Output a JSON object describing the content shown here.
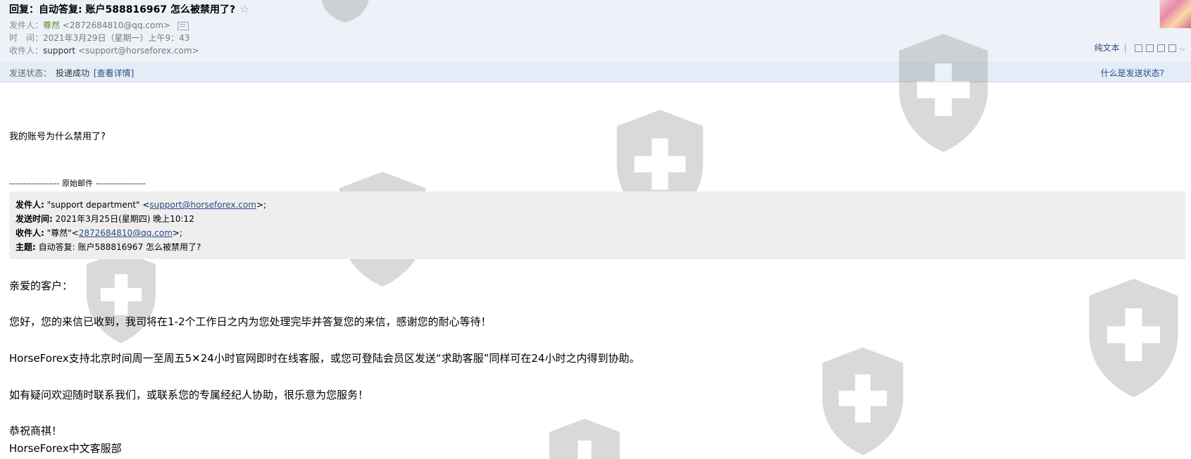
{
  "email": {
    "subject": "回复：自动答复: 账户588816967 怎么被禁用了?",
    "from": {
      "label": "发件人：",
      "name": "尊然",
      "address": "<2872684810@qq.com>"
    },
    "time": {
      "label": "时　间：",
      "value": "2021年3月29日（星期一）上午9：43"
    },
    "to": {
      "label": "收件人：",
      "name": "support",
      "address": "<support@horseforex.com>"
    }
  },
  "toolbar": {
    "plain_text": "纯文本",
    "separator": "|"
  },
  "status_bar": {
    "label": "发送状态：",
    "value": "投递成功",
    "details_link": "[查看详情]",
    "help_link": "什么是发送状态?"
  },
  "body": {
    "question": "我的账号为什么禁用了?",
    "original_separator": "------------------ 原始邮件 ------------------",
    "quoted": {
      "from_label": "发件人:",
      "from_prefix": " \"support department\" <",
      "from_link": "support@horseforex.com",
      "from_suffix": ">;",
      "sent_label": "发送时间:",
      "sent_value": " 2021年3月25日(星期四) 晚上10:12",
      "to_label": "收件人:",
      "to_prefix": " \"尊然\"<",
      "to_link": "2872684810@qq.com",
      "to_suffix": ">;",
      "subject_label": "主题:",
      "subject_value": " 自动答复: 账户588816967 怎么被禁用了?"
    },
    "greeting": "亲爱的客户：",
    "para1": "您好，您的来信已收到，我司将在1-2个工作日之内为您处理完毕并答复您的来信，感谢您的耐心等待！",
    "para2": "HorseForex支持北京时间周一至周五5✕24小时官网即时在线客服，或您可登陆会员区发送“求助客服”同样可在24小时之内得到协助。",
    "para3": "如有疑问欢迎随时联系我们，或联系您的专属经纪人协助，很乐意为您服务！",
    "closing": "恭祝商祺！",
    "signature": "HorseForex中文客服部"
  },
  "colors": {
    "header_bg": "#eef2f8",
    "status_bg": "#e3ecf7",
    "link": "#2a4b82",
    "sender_name": "#5a8a2c",
    "quote_bg": "#eeeeee"
  },
  "icons": [
    "star-icon",
    "vcard-icon",
    "avatar",
    "popout-icon",
    "window-icon",
    "save-icon",
    "print-icon",
    "chevron-down-icon",
    "shield-watermark-icon"
  ]
}
